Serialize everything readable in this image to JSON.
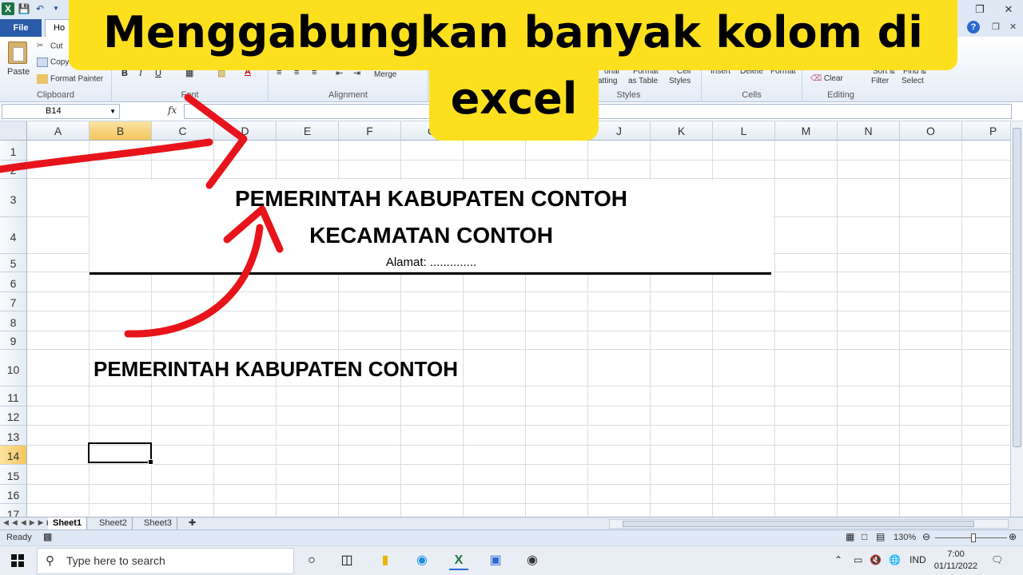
{
  "title_overlay": {
    "line1": "Menggabungkan banyak kolom di",
    "line2": "excel"
  },
  "ribbon": {
    "file_tab": "File",
    "home_tab": "Ho",
    "clipboard": {
      "cut": "Cut",
      "copy": "Copy",
      "format_painter": "Format Painter",
      "paste": "Paste",
      "label": "Clipboard"
    },
    "font": {
      "bold": "B",
      "italic": "I",
      "underline": "U",
      "label": "Font"
    },
    "alignment": {
      "merge": "Merge",
      "label": "Alignment"
    },
    "styles": {
      "conditional": "atting",
      "conditional_top": "onal",
      "format_table_top": "Format",
      "format_table": "as Table",
      "cell_styles_top": "Cell",
      "cell_styles": "Styles",
      "label": "Styles"
    },
    "cells": {
      "insert": "Insert",
      "delete": "Delete",
      "format": "Format",
      "label": "Cells"
    },
    "editing": {
      "clear": "Clear",
      "sort_top": "Sort &",
      "sort": "Filter",
      "find_top": "Find &",
      "find": "Select",
      "label": "Editing"
    }
  },
  "formula_bar": {
    "name_box": "B14",
    "fx": "fx",
    "value": ""
  },
  "columns": [
    "A",
    "B",
    "C",
    "D",
    "E",
    "F",
    "G",
    "H",
    "I",
    "J",
    "K",
    "L",
    "M",
    "N",
    "O",
    "P"
  ],
  "rows": [
    "1",
    "2",
    "3",
    "4",
    "5",
    "6",
    "7",
    "8",
    "9",
    "10",
    "11",
    "12",
    "13",
    "14",
    "15",
    "16",
    "17"
  ],
  "selected_column": "B",
  "selected_row": "14",
  "cells": {
    "header_line1": "PEMERINTAH KABUPATEN CONTOH",
    "header_line2": "KECAMATAN CONTOH",
    "address": "Alamat: ..............",
    "row10_text": "PEMERINTAH KABUPATEN CONTOH"
  },
  "sheets": [
    "Sheet1",
    "Sheet2",
    "Sheet3"
  ],
  "active_sheet": "Sheet1",
  "status": {
    "ready": "Ready",
    "zoom": "130%"
  },
  "taskbar": {
    "search_placeholder": "Type here to search",
    "lang": "IND",
    "time": "7:00",
    "date": "01/11/2022"
  },
  "colors": {
    "overlay_yellow": "#fce01e",
    "arrow_red": "#e8141b",
    "excel_green": "#1f7244",
    "file_tab_blue": "#2a5ba8"
  }
}
